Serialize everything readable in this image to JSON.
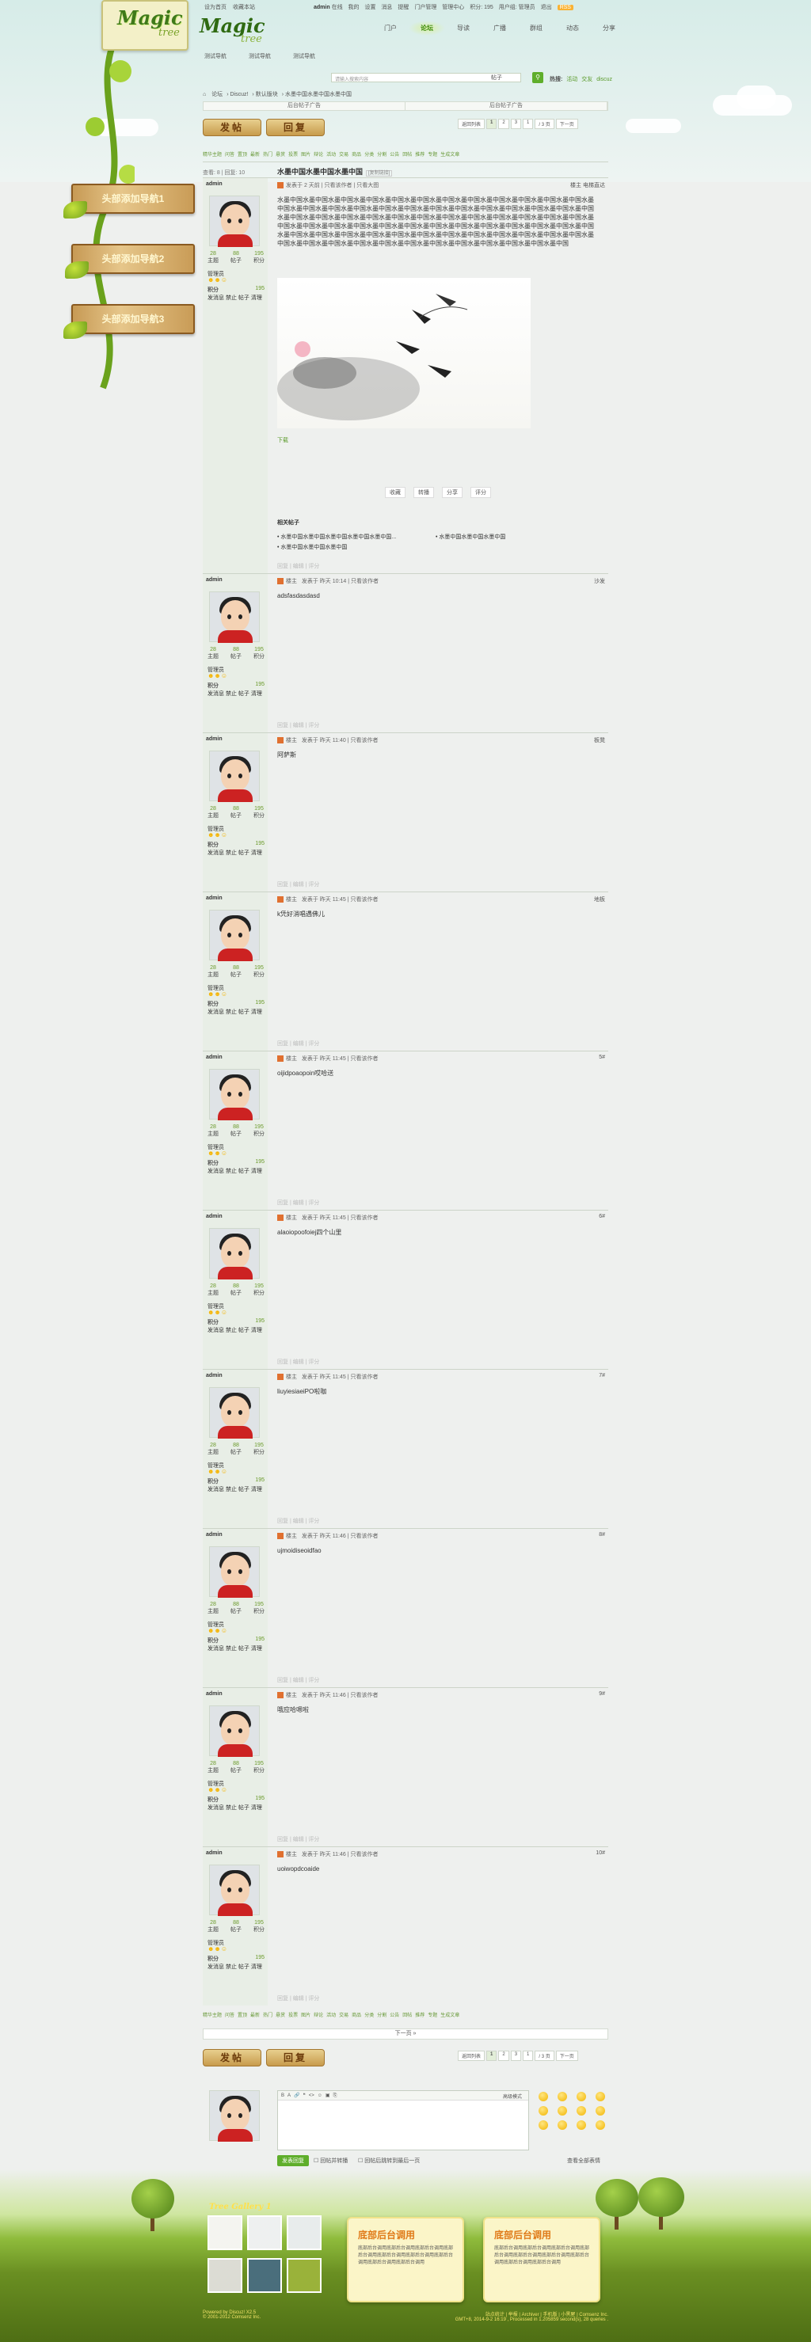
{
  "toplinks": {
    "home": "设为首页",
    "fav": "收藏本站"
  },
  "user": {
    "name": "admin",
    "items": [
      "在线",
      "我的",
      "设置",
      "消息",
      "提醒",
      "门户管理",
      "管理中心",
      "积分: 195",
      "用户组: 管理员",
      "退出"
    ],
    "rss": "RSS"
  },
  "mainnav": [
    {
      "label": "门户",
      "on": false
    },
    {
      "label": "论坛",
      "on": true
    },
    {
      "label": "导读",
      "on": false
    },
    {
      "label": "广播",
      "on": false
    },
    {
      "label": "群组",
      "on": false
    },
    {
      "label": "动态",
      "on": false
    },
    {
      "label": "分享",
      "on": false
    }
  ],
  "subnav": [
    "测试导航",
    "测试导航",
    "测试导航"
  ],
  "search": {
    "placeholder": "请输入搜索内容",
    "type": "帖子",
    "hot_label": "热搜:",
    "hot": [
      "活动",
      "交友",
      "discuz"
    ]
  },
  "crumb": [
    "论坛",
    "Discuz!",
    "默认版块",
    "水墨中国水墨中国水墨中国"
  ],
  "ads": [
    "后台帖子广告",
    "后台帖子广告"
  ],
  "buttons": {
    "post": "发帖",
    "reply": "回复"
  },
  "pager": {
    "back": "返回列表",
    "pages": [
      "1",
      "2",
      "3"
    ],
    "jump": "1",
    "total": "/ 3 页",
    "next": "下一页"
  },
  "tabs": [
    "精华主题",
    "问答",
    "置顶",
    "最新",
    "热门",
    "悬赏",
    "投票",
    "图片",
    "辩论",
    "活动",
    "交易",
    "商品",
    "分类",
    "分割",
    "公告",
    "回帖",
    "推荐",
    "专题",
    "生成文章"
  ],
  "sidebar_nav": [
    "头部添加导航1",
    "头部添加导航2",
    "头部添加导航3"
  ],
  "thread": {
    "views_label": "查看: 8",
    "replies_label": "回复: 10",
    "title": "水墨中国水墨中国水墨中国",
    "copy": "[复制链接]"
  },
  "first_post": {
    "author": "admin",
    "stats": [
      {
        "v": "28",
        "k": "主题"
      },
      {
        "v": "88",
        "k": "帖子"
      },
      {
        "v": "195",
        "k": "积分"
      }
    ],
    "group": "管理员",
    "points_label": "积分",
    "points": "195",
    "ops": "发消息 禁止 帖子 清理",
    "meta": "发表于 2 天前  |  只看该作者  |  只看大图",
    "author_tag": "楼主",
    "floor": "电梯直达",
    "body": "水墨中国水墨中国水墨中国水墨中国水墨中国水墨中国水墨中国水墨中国水墨中国水墨中国水墨中国水墨中国水墨中国水墨中国水墨中国水墨中国水墨中国水墨中国水墨中国水墨中国水墨中国水墨中国水墨中国水墨中国水墨中国水墨中国水墨中国水墨中国水墨中国水墨中国水墨中国水墨中国水墨中国水墨中国水墨中国水墨中国水墨中国水墨中国水墨中国水墨中国水墨中国水墨中国水墨中国水墨中国水墨中国水墨中国水墨中国水墨中国水墨中国水墨中国水墨中国水墨中国水墨中国水墨中国水墨中国水墨中国水墨中国水墨中国水墨中国水墨中国水墨中国水墨中国水墨中国水墨中国水墨中国水墨中国水墨中国水墨中国水墨中国水墨中国水墨中国水墨中国水墨中国水墨中国",
    "download": "下载",
    "share": [
      "收藏",
      "转播",
      "分享",
      "评分"
    ],
    "related_title": "相关帖子",
    "related": [
      "水墨中国水墨中国水墨中国水墨中国水墨中国...",
      "水墨中国水墨中国水墨中国",
      "水墨中国水墨中国水墨中国"
    ],
    "foot": "回复  |  编辑  |  评分"
  },
  "replies": [
    {
      "meta": "发表于 昨天 10:14  |  只看该作者",
      "body": "adsfasdasdasd",
      "floor": "沙发"
    },
    {
      "meta": "发表于 昨天 11:40  |  只看该作者",
      "body": "阿萨斯",
      "floor": "板凳"
    },
    {
      "meta": "发表于 昨天 11:45  |  只看该作者",
      "body": "k凭好消唱遇佛儿",
      "floor": "地板"
    },
    {
      "meta": "发表于 昨天 11:45  |  只看该作者",
      "body": "oijidpoaopoin哎哈送",
      "floor": "5#"
    },
    {
      "meta": "发表于 昨天 11:45  |  只看该作者",
      "body": "alaoiopoofoiej四个山里",
      "floor": "6#"
    },
    {
      "meta": "发表于 昨天 11:45  |  只看该作者",
      "body": "liuyiesiaeiPO啦咖",
      "floor": "7#"
    },
    {
      "meta": "发表于 昨天 11:46  |  只看该作者",
      "body": "ujmoidiseoidfao",
      "floor": "8#"
    },
    {
      "meta": "发表于 昨天 11:46  |  只看该作者",
      "body": "哦应哈嗯啦",
      "floor": "9#"
    },
    {
      "meta": "发表于 昨天 11:46  |  只看该作者",
      "body": "uoiwopdcoaide",
      "floor": "10#"
    }
  ],
  "nextpage": "下一页 »",
  "fastpost": {
    "adv": "高级模式",
    "submit": "发表回复",
    "opt1": "回帖并转播",
    "opt2": "回帖后跳转到最后一页",
    "all_smilies": "查看全部表情"
  },
  "gallery_title": "Tree Gallery 1",
  "scrolls": [
    {
      "title": "底部后台调用",
      "body": "底部后台调用底部后台调用底部后台调用底部后台调用底部后台调用底部后台调用底部后台调用底部后台调用底部后台调用"
    },
    {
      "title": "底部后台调用",
      "body": "底部后台调用底部后台调用底部后台调用底部后台调用底部后台调用底部后台调用底部后台调用底部后台调用底部后台调用"
    }
  ],
  "footer": {
    "left1": "Powered by Discuz! X2.5",
    "left2": "© 2001-2012 Comsenz Inc.",
    "right1": "站点统计 | 举报 | Archiver | 手机版 | 小黑屋 | Comsenz Inc.",
    "right2": "GMT+8, 2014-9-2 16:19 , Processed in 1.205859 second(s), 28 queries ."
  }
}
